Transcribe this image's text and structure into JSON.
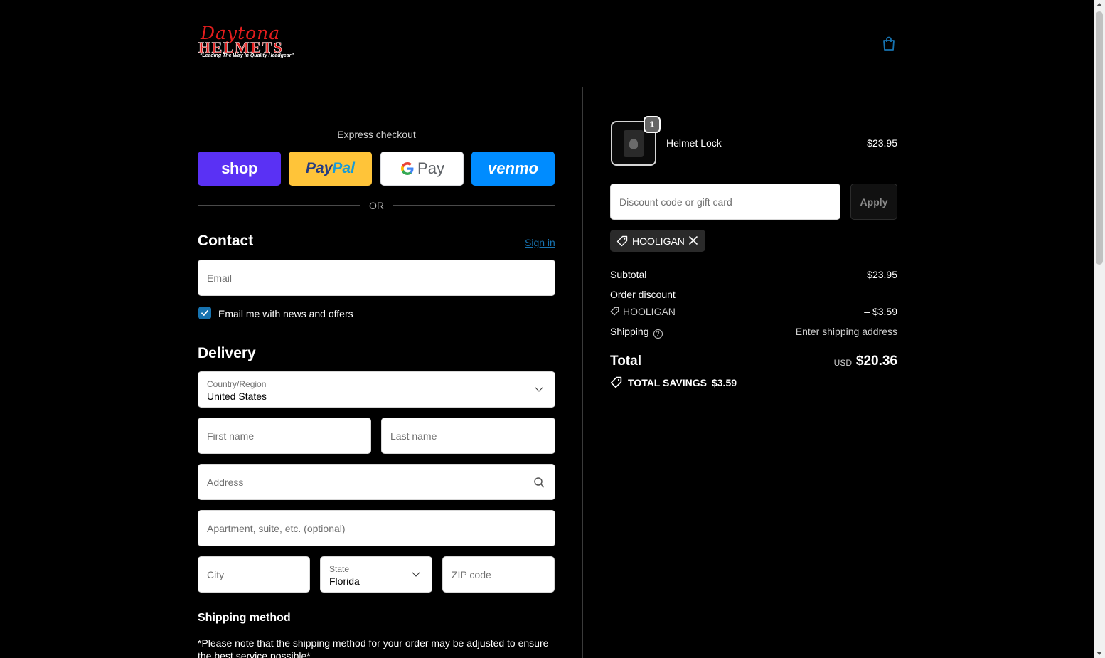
{
  "brand": {
    "logo_script": "Daytona",
    "logo_word": "HELMETS",
    "logo_tagline": "\"Leading The Way In Quality Headgear\""
  },
  "express": {
    "title": "Express checkout",
    "shop_label": "shop",
    "paypal_part1": "Pay",
    "paypal_part2": "Pal",
    "gpay_label": "Pay",
    "venmo_label": "venmo",
    "or_label": "OR"
  },
  "contact": {
    "heading": "Contact",
    "sign_in": "Sign in",
    "email_placeholder": "Email",
    "newsletter_label": "Email me with news and offers",
    "newsletter_checked": true
  },
  "delivery": {
    "heading": "Delivery",
    "country_label": "Country/Region",
    "country_value": "United States",
    "first_name_placeholder": "First name",
    "last_name_placeholder": "Last name",
    "address_placeholder": "Address",
    "apartment_placeholder": "Apartment, suite, etc. (optional)",
    "city_placeholder": "City",
    "state_label": "State",
    "state_value": "Florida",
    "zip_placeholder": "ZIP code"
  },
  "shipping": {
    "heading": "Shipping method",
    "note": "*Please note that the shipping method for your order may be adjusted to ensure the best service possible*"
  },
  "summary": {
    "item": {
      "name": "Helmet Lock",
      "price": "$23.95",
      "quantity": "1"
    },
    "discount_placeholder": "Discount code or gift card",
    "apply_label": "Apply",
    "applied_code": "HOOLIGAN",
    "subtotal_label": "Subtotal",
    "subtotal_value": "$23.95",
    "order_discount_label": "Order discount",
    "discount_code": "HOOLIGAN",
    "discount_value": "– $3.59",
    "shipping_label": "Shipping",
    "shipping_value": "Enter shipping address",
    "total_label": "Total",
    "total_currency": "USD",
    "total_value": "$20.36",
    "savings_label": "TOTAL SAVINGS",
    "savings_value": "$3.59"
  },
  "colors": {
    "accent": "#1773b0",
    "background": "#000000",
    "shop": "#5a31f4",
    "paypal": "#ffc439",
    "venmo": "#008cff"
  }
}
